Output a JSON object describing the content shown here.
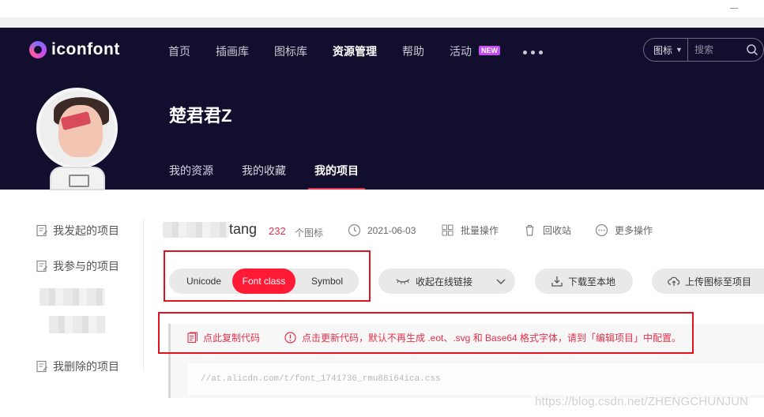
{
  "brand": {
    "name": "iconfont"
  },
  "nav": {
    "items": [
      "首页",
      "插画库",
      "图标库",
      "资源管理",
      "帮助",
      "活动"
    ],
    "active_index": 3,
    "new_badge": "NEW"
  },
  "search": {
    "type_label": "图标",
    "placeholder": "搜索"
  },
  "profile": {
    "name": "楚君君Z",
    "tabs": [
      "我的资源",
      "我的收藏",
      "我的项目"
    ],
    "active_tab": 2
  },
  "sidebar": {
    "items": [
      "我发起的项目",
      "我参与的项目",
      "我删除的项目"
    ]
  },
  "project": {
    "name_visible": "tang",
    "icon_count": "232",
    "icon_count_label": "个图标",
    "date": "2021-06-03",
    "actions": [
      "批量操作",
      "回收站",
      "更多操作"
    ]
  },
  "font_modes": {
    "options": [
      "Unicode",
      "Font class",
      "Symbol"
    ],
    "selected": "Font class"
  },
  "toolbar": {
    "collapse_label": "收起在线链接",
    "download_label": "下载至本地",
    "upload_label": "上传图标至项目"
  },
  "code": {
    "copy_label": "点此复制代码",
    "notice": "点击更新代码，默认不再生成 .eot、.svg 和 Base64 格式字体，请到「编辑项目」中配置。",
    "link": "//at.alicdn.com/t/font_1741736_rmu88i64ica.css"
  },
  "watermark": "https://blog.csdn.net/ZHENGCHUNJUN",
  "colors": {
    "accent": "#ff1a36",
    "hero_bg": "#120f2e",
    "new_badge": "#c34cf2"
  }
}
